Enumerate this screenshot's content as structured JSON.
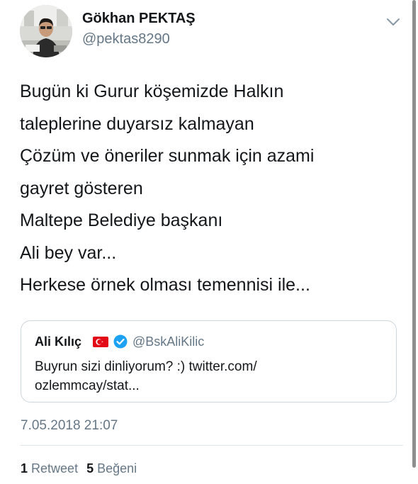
{
  "author": {
    "display_name": "Gökhan PEKTAŞ",
    "handle": "@pektas8290"
  },
  "tweet": {
    "lines": [
      "Bugün ki Gurur köşemizde Halkın",
      "taleplerine duyarsız kalmayan",
      "Çözüm ve öneriler sunmak için azami",
      "gayret gösteren",
      "Maltepe Belediye başkanı",
      "Ali bey var...",
      "Herkese örnek olması temennisi ile..."
    ],
    "timestamp": "7.05.2018 21:07"
  },
  "quoted_tweet": {
    "name": "Ali Kılıç",
    "handle": "@BskAliKilic",
    "flag_icon": "turkey-flag-icon",
    "verified_icon": "verified-badge-icon",
    "body_lines": [
      "Buyrun sizi dinliyorum? :) twitter.com/",
      "ozlemmcay/stat..."
    ]
  },
  "stats": {
    "retweet_count": "1",
    "retweet_label": "Retweet",
    "like_count": "5",
    "like_label": "Beğeni"
  },
  "colors": {
    "text_primary": "#14171a",
    "text_secondary": "#657786",
    "border": "#ccd6dd",
    "verified_blue": "#1da1f2",
    "flag_red": "#e30a17"
  }
}
